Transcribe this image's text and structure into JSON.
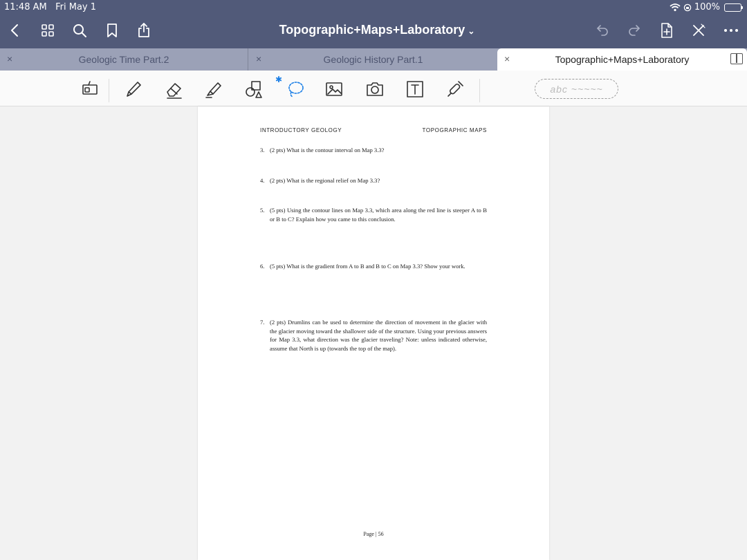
{
  "status": {
    "time": "11:48 AM",
    "date": "Fri May 1",
    "battery": "100%"
  },
  "nav": {
    "title": "Topographic+Maps+Laboratory",
    "left_icons": [
      "back-chevron-icon",
      "grid-icon",
      "search-icon",
      "bookmark-icon",
      "share-icon"
    ],
    "right_icons": [
      "undo-icon",
      "redo-icon",
      "add-page-icon",
      "close-pen-icon",
      "more-icon"
    ]
  },
  "tabs": [
    {
      "label": "Geologic Time Part.2",
      "close": "×",
      "active": false
    },
    {
      "label": "Geologic History Part.1",
      "close": "×",
      "active": false
    },
    {
      "label": "Topographic+Maps+Laboratory",
      "close": "×",
      "active": true
    }
  ],
  "toolbar": {
    "tools": [
      "zoom-window-icon",
      "pen-icon",
      "eraser-icon",
      "highlighter-icon",
      "shapes-icon",
      "lasso-icon",
      "image-icon",
      "camera-icon",
      "text-icon",
      "laser-pointer-icon"
    ],
    "handwriting_placeholder": "abc ~~~~~",
    "accent_color": "#1a7ee6"
  },
  "document": {
    "header_left": "INTRODUCTORY GEOLOGY",
    "header_right": "TOPOGRAPHIC MAPS",
    "questions": [
      {
        "num": "3.",
        "text": "(2 pts) What is the contour interval on Map 3.3?"
      },
      {
        "num": "4.",
        "text": "(2 pts) What is the regional relief on Map 3.3?"
      },
      {
        "num": "5.",
        "text": "(5 pts) Using the contour lines on Map 3.3, which area along the red line is steeper A to B or B to C? Explain how you came to this conclusion."
      },
      {
        "num": "6.",
        "text": "(5 pts) What is the gradient from A to B and B to C on Map 3.3? Show your work."
      },
      {
        "num": "7.",
        "text": "(2 pts) Drumlins can be used to determine the direction of movement in the glacier with the glacier moving toward the shallower side of the structure. Using your previous answers for Map 3.3, what direction was the glacier traveling? Note: unless indicated otherwise, assume that North is up (towards the top of the map)."
      }
    ],
    "footer": "Page | 56"
  },
  "colors": {
    "nav_bg": "#515a79",
    "tab_bg": "#9ba1b7",
    "page_bg": "#ffffff",
    "canvas_bg": "#f2f2f2"
  }
}
